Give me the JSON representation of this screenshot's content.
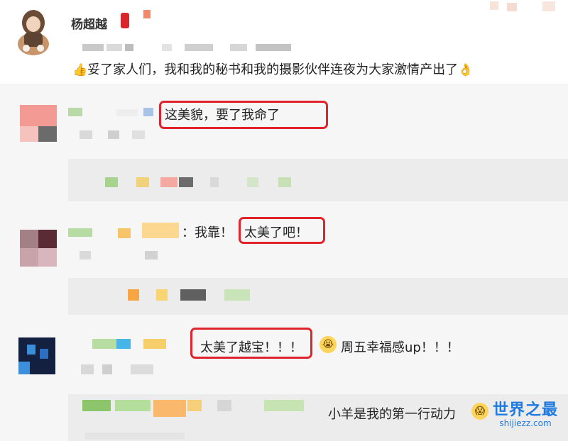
{
  "post": {
    "author": "杨超越",
    "text": "妥了家人们，我和我的秘书和我的摄影伙伴连夜为大家激情产出了",
    "leading_emoji": "👍",
    "trailing_emoji": "👌"
  },
  "comments": [
    {
      "text_prefix": ":",
      "text": "这美貌，要了我命了",
      "highlighted": "这美貌，要了我命了"
    },
    {
      "text_prefix": "：我靠！",
      "text": "太美了吧！",
      "highlighted": "太美了吧！"
    },
    {
      "highlighted": "太美了越宝！！！",
      "text_after": "周五幸福感up！！！",
      "emoji": "😭"
    }
  ],
  "reply_last": {
    "text": "小羊是我的第一行动力",
    "emoji": "😱"
  },
  "watermark": {
    "main": "世界之最",
    "sub": "shijiezz.com"
  },
  "colors": {
    "highlight": "#e1242b",
    "watermark": "#1f7be0",
    "comment_bg": "#f6f6f6",
    "reply_bg": "#ececec"
  }
}
